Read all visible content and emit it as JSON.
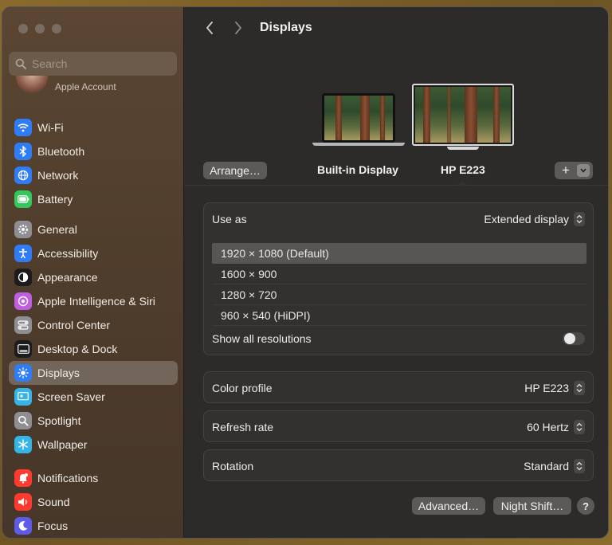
{
  "sidebar": {
    "search_placeholder": "Search",
    "account_label": "Apple Account",
    "groups": [
      [
        {
          "label": "Wi-Fi",
          "icon": "wifi-icon",
          "color": "#2f7cf6"
        },
        {
          "label": "Bluetooth",
          "icon": "bluetooth-icon",
          "color": "#2f7cf6"
        },
        {
          "label": "Network",
          "icon": "globe-icon",
          "color": "#2f7cf6"
        },
        {
          "label": "Battery",
          "icon": "battery-icon",
          "color": "#34c759"
        }
      ],
      [
        {
          "label": "General",
          "icon": "gear-icon",
          "color": "#8e8e93"
        },
        {
          "label": "Accessibility",
          "icon": "accessibility-icon",
          "color": "#2f7cf6"
        },
        {
          "label": "Appearance",
          "icon": "appearance-icon",
          "color": "#1c1c1e"
        },
        {
          "label": "Apple Intelligence & Siri",
          "icon": "siri-icon",
          "color": "#c05de0"
        },
        {
          "label": "Control Center",
          "icon": "control-center-icon",
          "color": "#8e8e93"
        },
        {
          "label": "Desktop & Dock",
          "icon": "dock-icon",
          "color": "#1c1c1e"
        },
        {
          "label": "Displays",
          "icon": "sun-icon",
          "color": "#2f7cf6",
          "active": true
        },
        {
          "label": "Screen Saver",
          "icon": "screen-saver-icon",
          "color": "#36b4e8"
        },
        {
          "label": "Spotlight",
          "icon": "magnifier-icon",
          "color": "#8e8e93"
        },
        {
          "label": "Wallpaper",
          "icon": "snowflake-icon",
          "color": "#36b4e8"
        }
      ],
      [
        {
          "label": "Notifications",
          "icon": "bell-icon",
          "color": "#ff3b30"
        },
        {
          "label": "Sound",
          "icon": "speaker-icon",
          "color": "#ff3b30"
        },
        {
          "label": "Focus",
          "icon": "moon-icon",
          "color": "#5e5ce6"
        }
      ]
    ]
  },
  "header": {
    "title": "Displays"
  },
  "arrangement": {
    "arrange_label": "Arrange…",
    "builtin_label": "Built-in Display",
    "external_label": "HP E223"
  },
  "use_as": {
    "label": "Use as",
    "value": "Extended display",
    "resolutions": [
      "1920 × 1080 (Default)",
      "1600 × 900",
      "1280 × 720",
      "960 × 540 (HiDPI)"
    ],
    "selected_index": 0,
    "show_all_label": "Show all resolutions"
  },
  "settings": [
    {
      "label": "Color profile",
      "value": "HP E223"
    },
    {
      "label": "Refresh rate",
      "value": "60 Hertz"
    },
    {
      "label": "Rotation",
      "value": "Standard"
    }
  ],
  "footer": {
    "advanced_label": "Advanced…",
    "night_shift_label": "Night Shift…",
    "help_label": "?"
  }
}
